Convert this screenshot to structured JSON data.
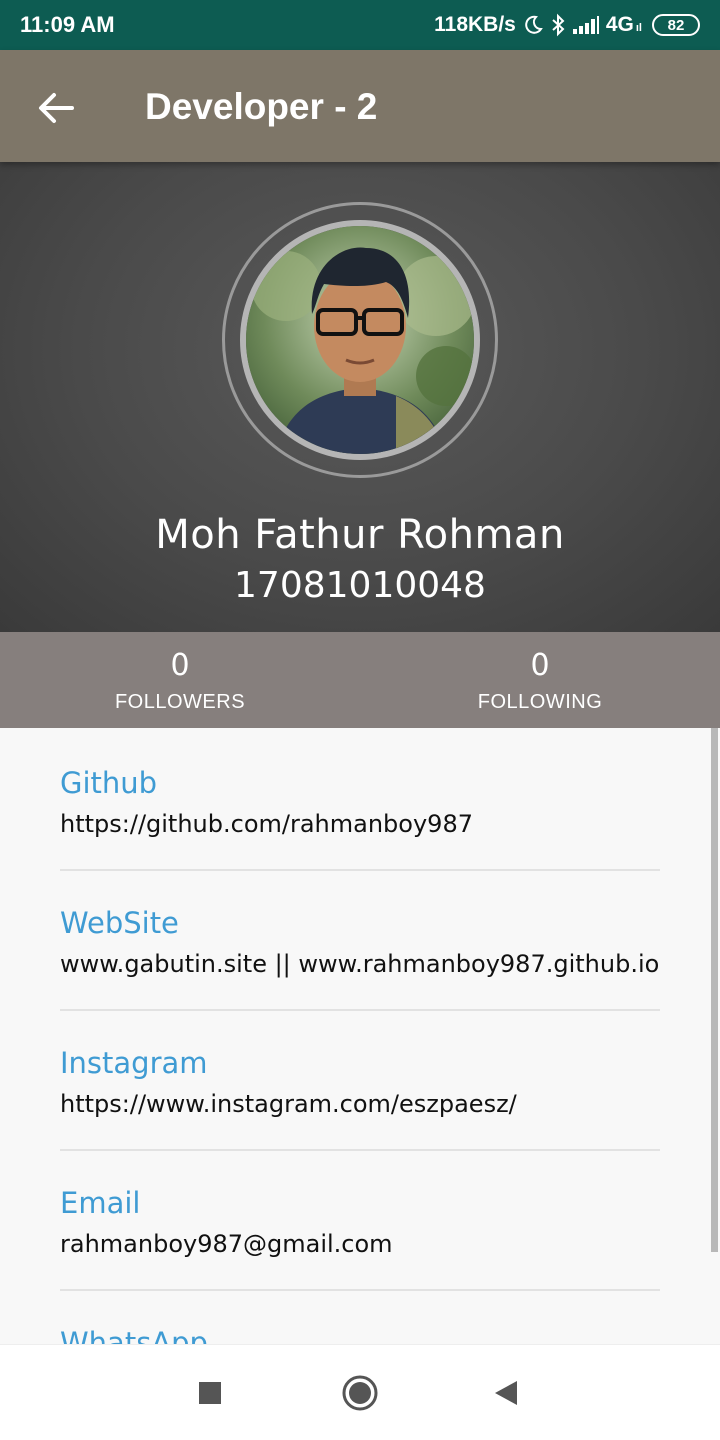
{
  "status_bar": {
    "time": "11:09 AM",
    "network_speed": "118KB/s",
    "network_type": "4G",
    "network_sub": "ıl",
    "battery": "82",
    "icons": [
      "moon-icon",
      "bluetooth-icon",
      "signal-icon",
      "battery-icon"
    ]
  },
  "app_bar": {
    "title": "Developer - 2",
    "back_icon": "arrow-back-icon"
  },
  "profile": {
    "name": "Moh Fathur Rohman",
    "nim": "17081010048",
    "avatar_icon": "profile-photo"
  },
  "stats": {
    "followers": {
      "value": "0",
      "label": "FOLLOWERS"
    },
    "following": {
      "value": "0",
      "label": "FOLLOWING"
    }
  },
  "info": {
    "items": [
      {
        "title": "Github",
        "value": "https://github.com/rahmanboy987"
      },
      {
        "title": "WebSite",
        "value": "www.gabutin.site || www.rahmanboy987.github.io"
      },
      {
        "title": "Instagram",
        "value": "https://www.instagram.com/eszpaesz/"
      },
      {
        "title": "Email",
        "value": "rahmanboy987@gmail.com"
      },
      {
        "title": "WhatsApp",
        "value": ""
      }
    ]
  },
  "nav_bar": {
    "icons": [
      "recents-square-icon",
      "home-circle-icon",
      "back-triangle-icon"
    ]
  },
  "colors": {
    "status_bar": "#0d5c52",
    "app_bar": "#7e7668",
    "header_bg": "#4a4a4a",
    "stats_bar": "#867f7d",
    "link_title": "#3f9bd3"
  }
}
